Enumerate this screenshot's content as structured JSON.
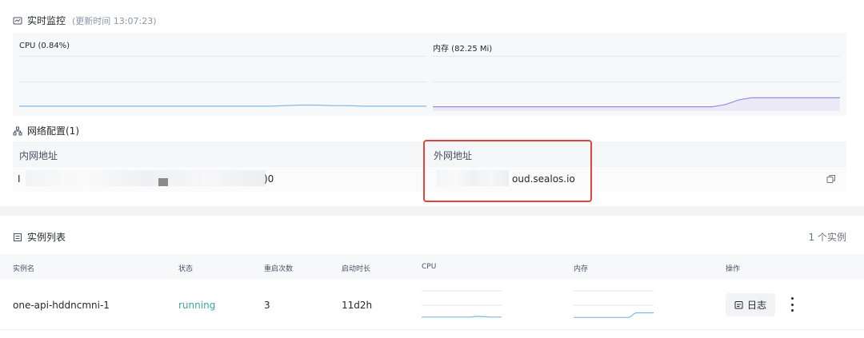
{
  "monitor": {
    "title": "实时监控",
    "updated": "(更新时间 13:07:23)",
    "cpu_label": "CPU (0.84%)",
    "memory_label": "内存 (82.25 Mi)",
    "series_colors": {
      "cpu": "#7fb7e6",
      "memory": "#9b8ee6"
    },
    "cpu_trend": [
      0.03,
      0.03,
      0.03,
      0.03,
      0.03,
      0.03,
      0.03,
      0.03,
      0.03,
      0.03,
      0.03,
      0.03,
      0.03,
      0.03,
      0.03,
      0.03,
      0.03,
      0.04,
      0.05,
      0.05,
      0.04,
      0.04,
      0.03,
      0.03,
      0.03,
      0.03,
      0.03
    ],
    "memory_trend": [
      0.02,
      0.02,
      0.02,
      0.02,
      0.02,
      0.02,
      0.02,
      0.02,
      0.02,
      0.02,
      0.02,
      0.02,
      0.02,
      0.02,
      0.02,
      0.02,
      0.02,
      0.02,
      0.02,
      0.02,
      0.02,
      0.02,
      0.02,
      0.06,
      0.14,
      0.18,
      0.18,
      0.18,
      0.18,
      0.18,
      0.18,
      0.18,
      0.18
    ]
  },
  "network": {
    "title": "网络配置(1)",
    "internal_header": "内网地址",
    "external_header": "外网地址",
    "internal_prefix": "I",
    "internal_suffix": ")0",
    "external_value": "oud.sealos.io"
  },
  "instances": {
    "title": "实例列表",
    "count": "1 个实例",
    "columns": {
      "name": "实例名",
      "status": "状态",
      "restarts": "重启次数",
      "uptime": "启动时长",
      "cpu": "CPU",
      "memory": "内存",
      "actions": "操作"
    },
    "rows": [
      {
        "name": "one-api-hddncmni-1",
        "status": "running",
        "restarts": "3",
        "uptime": "11d2h",
        "log_label": "日志"
      }
    ],
    "status_color": "#3aa7a4"
  }
}
